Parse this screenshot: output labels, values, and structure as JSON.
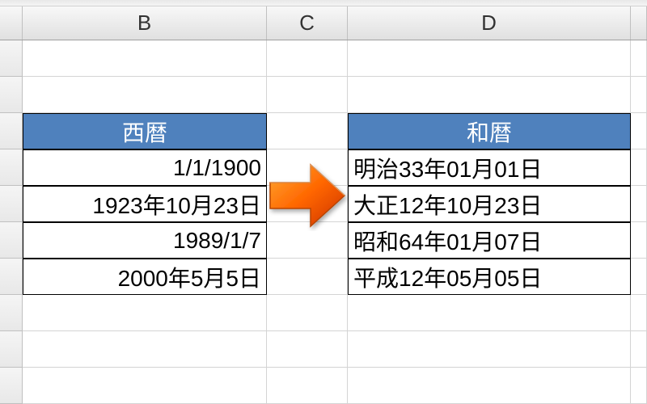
{
  "columns": {
    "B": "B",
    "C": "C",
    "D": "D"
  },
  "tableLeft": {
    "header": "西暦",
    "rows": [
      "1/1/1900",
      "1923年10月23日",
      "1989/1/7",
      "2000年5月5日"
    ]
  },
  "tableRight": {
    "header": "和暦",
    "rows": [
      "明治33年01月01日",
      "大正12年10月23日",
      "昭和64年01月07日",
      "平成12年05月05日"
    ]
  },
  "arrow": {
    "iconName": "arrow-right-icon"
  }
}
